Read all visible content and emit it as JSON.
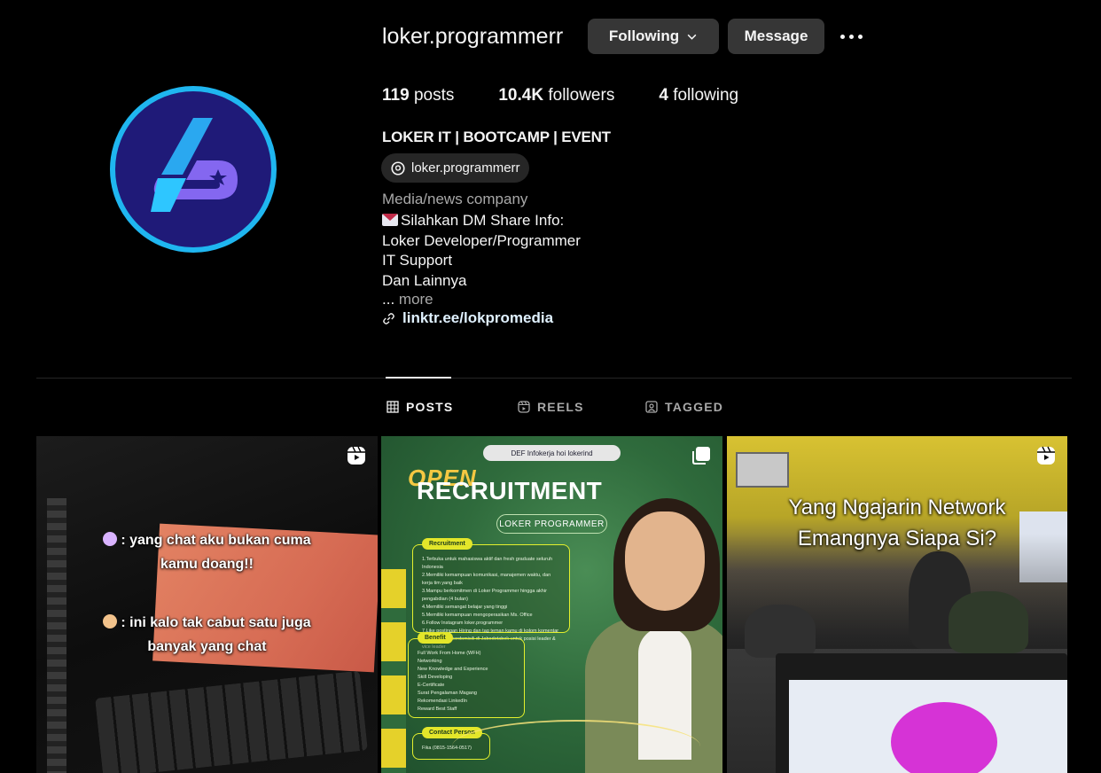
{
  "profile": {
    "username": "loker.programmerr",
    "following_button": "Following",
    "message_button": "Message",
    "stats": {
      "posts_count": "119",
      "posts_label": "posts",
      "followers_count": "10.4K",
      "followers_label": "followers",
      "following_count": "4",
      "following_label": "following"
    },
    "full_name": "LOKER IT | BOOTCAMP | EVENT",
    "threads_handle": "loker.programmerr",
    "category": "Media/news company",
    "bio_lines": [
      "Silahkan DM Share Info:",
      "Loker Developer/Programmer",
      "IT Support",
      "Dan Lainnya"
    ],
    "more_ellipsis": "...",
    "more_label": "more",
    "link": "linktr.ee/lokpromedia"
  },
  "tabs": [
    {
      "label": "POSTS",
      "icon": "grid-icon",
      "active": true
    },
    {
      "label": "REELS",
      "icon": "reels-icon",
      "active": false
    },
    {
      "label": "TAGGED",
      "icon": "tagged-icon",
      "active": false
    }
  ],
  "posts": [
    {
      "type": "reel",
      "icon": "reel-icon",
      "overlay_lines_a": [
        ": yang chat aku bukan cuma",
        "kamu doang!!"
      ],
      "overlay_lines_b": [
        ": ini kalo tak cabut satu juga",
        "banyak yang chat"
      ]
    },
    {
      "type": "carousel",
      "icon": "carousel-icon",
      "logos_text": "DEF  Infokerja  hoi  lokerind",
      "open_text": "OPEN",
      "recruitment_text": "RECRUITMENT",
      "pill_text": "LOKER PROGRAMMER",
      "box1_header": "Recruitment",
      "box1_lines": [
        "1.Terbuka untuk mahasiswa aktif dan fresh graduate seluruh Indonesia",
        "2.Memiliki kemampuan komunikasi, manajemen waktu, dan kerja tim yang baik",
        "3.Mampu berkomitmen di Loker Programmer hingga akhir pengabdian (4 bulan)",
        "4.Memiliki semangat belajar yang tinggi",
        "5.Memiliki kemampuan mengoperasikan Ms. Office",
        "6.Follow Instagram loker.programmer",
        "7.Like postingan Hiring dan tag teman kamu di kolom komentar",
        "*Diutamakan berdomisili di Jabodetabek untuk posisi leader & vice leader"
      ],
      "box2_header": "Benefit",
      "box2_lines": [
        "Full Work From Home (WFH)",
        "Networking",
        "New Knowledge and Experience",
        "Skill Developing",
        "E-Certificate",
        "Surat Pengalaman Magang",
        "Rekomendasi LinkedIn",
        "Reward Best Staff"
      ],
      "box3_header": "Contact Person",
      "box3_line": "Fika (0815-1564-0517)"
    },
    {
      "type": "reel",
      "icon": "reel-icon",
      "overlay_line_a": "Yang Ngajarin Network",
      "overlay_line_b": "Emangnya Siapa Si?"
    }
  ],
  "colors": {
    "background": "#000000",
    "button_bg": "#363636",
    "avatar_ring": "#1fb6f0",
    "avatar_fill": "#1f1a78",
    "muted_text": "#a8a8a8",
    "link_text": "#e0f1ff"
  }
}
